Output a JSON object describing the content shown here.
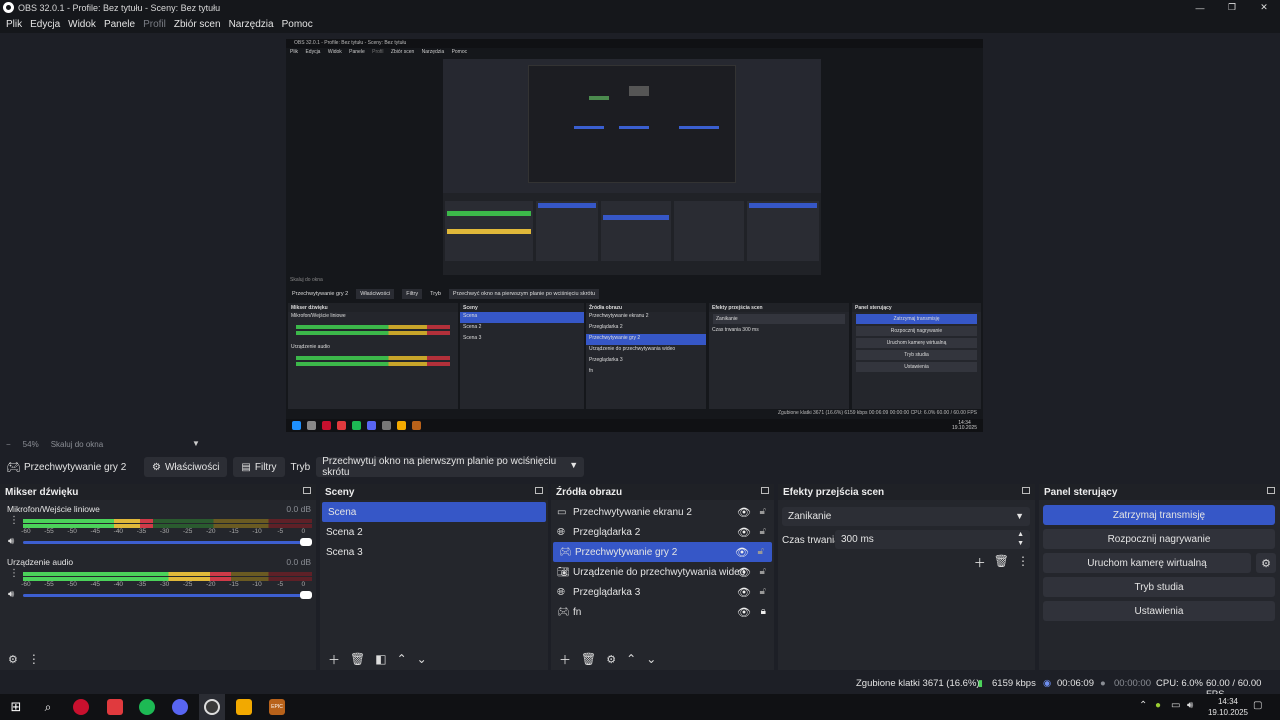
{
  "window": {
    "title": "OBS 32.0.1 - Profile: Bez tytułu - Sceny: Bez tytułu",
    "controls": {
      "minimize": "—",
      "restore": "❐",
      "close": "✕"
    }
  },
  "menu": [
    "Plik",
    "Edycja",
    "Widok",
    "Panele",
    "Profil",
    "Zbiór scen",
    "Narzędzia",
    "Pomoc"
  ],
  "menu_disabled": "Profil",
  "preview_nested": {
    "title": "OBS 32.0.1 - Profile: Bez tytułu - Sceny: Bez tytułu",
    "menu": [
      "Plik",
      "Edycja",
      "Widok",
      "Panele",
      "Profil",
      "Zbiór scen",
      "Narzędzia",
      "Pomoc"
    ],
    "scale": "Skaluj do okna",
    "source_name": "Przechwytywanie gry 2",
    "properties": "Właściwości",
    "filters": "Filtry",
    "mode_label": "Tryb",
    "mode_value": "Przechwyć okno na pierwszym planie po wciśnięciu skrótu",
    "docks": {
      "mixer": "Mikser dźwięku",
      "scenes": "Sceny",
      "sources": "Źródła obrazu",
      "transitions": "Efekty przejścia scen",
      "controls": "Panel sterujący"
    },
    "mixer_tracks": [
      "Mikrofon/Wejście liniowe",
      "Urządzenie audio"
    ],
    "scenes": [
      "Scena",
      "Scena 2",
      "Scena 3"
    ],
    "sources": [
      "Przechwytywanie ekranu 2",
      "Przeglądarka 2",
      "Przechwytywanie gry 2",
      "Urządzenie do przechwytywania wideo",
      "Przeglądarka 3",
      "fn"
    ],
    "transition": "Zanikanie",
    "duration_label": "Czas trwania",
    "duration": "300 ms",
    "controls": [
      "Zatrzymaj transmisję",
      "Rozpocznij nagrywanie",
      "Uruchom kamerę wirtualną",
      "Tryb studia",
      "Ustawienia"
    ],
    "status": "Zgubione klatki 3671 (16.6%)   6159 kbps   00:06:09   00:00:00   CPU: 6.0%   60.00 / 60.00 FPS",
    "clock_time": "14:34",
    "clock_date": "19.10.2025"
  },
  "zoom": {
    "minus": "−",
    "value": "54%",
    "scale_label": "Skaluj do okna"
  },
  "source_toolbar": {
    "source_name": "Przechwytywanie gry 2",
    "properties": "Właściwości",
    "filters": "Filtry",
    "mode_label": "Tryb",
    "mode_value": "Przechwytuj okno na pierwszym planie po wciśnięciu skrótu"
  },
  "mixer": {
    "title": "Mikser dźwięku",
    "tracks": [
      {
        "name": "Mikrofon/Wejście liniowe",
        "db": "0.0 dB",
        "level": 0.45
      },
      {
        "name": "Urządzenie audio",
        "db": "0.0 dB",
        "level": 0.72
      }
    ],
    "ticks": [
      "-60",
      "-55",
      "-50",
      "-45",
      "-40",
      "-35",
      "-30",
      "-25",
      "-20",
      "-15",
      "-10",
      "-5",
      "0"
    ]
  },
  "scenes": {
    "title": "Sceny",
    "items": [
      "Scena",
      "Scena 2",
      "Scena 3"
    ],
    "selected_index": 0
  },
  "sources": {
    "title": "Źródła obrazu",
    "items": [
      {
        "name": "Przechwytywanie ekranu 2",
        "icon": "monitor-icon",
        "locked": false
      },
      {
        "name": "Przeglądarka 2",
        "icon": "globe-icon",
        "locked": false
      },
      {
        "name": "Przechwytywanie gry 2",
        "icon": "gamepad-icon",
        "locked": false
      },
      {
        "name": "Urządzenie do przechwytywania wideo",
        "icon": "camera-icon",
        "locked": false
      },
      {
        "name": "Przeglądarka 3",
        "icon": "globe-icon",
        "locked": false
      },
      {
        "name": "fn",
        "icon": "gamepad-icon",
        "locked": true
      }
    ],
    "selected_index": 2
  },
  "transitions": {
    "title": "Efekty przejścia scen",
    "transition": "Zanikanie",
    "duration_label": "Czas trwania",
    "duration": "300 ms"
  },
  "controls": {
    "title": "Panel sterujący",
    "stream": "Zatrzymaj transmisję",
    "record": "Rozpocznij nagrywanie",
    "virtualcam": "Uruchom kamerę wirtualną",
    "studio": "Tryb studia",
    "settings": "Ustawienia"
  },
  "status": {
    "dropped": "Zgubione klatki 3671 (16.6%)",
    "bitrate": "6159 kbps",
    "stream_time": "00:06:09",
    "rec_time": "00:00:00",
    "cpu": "CPU: 6.0%",
    "fps": "60.00 / 60.00 FPS"
  },
  "taskbar": {
    "time": "14:34",
    "date": "19.10.2025",
    "apps": [
      "windows-start-icon",
      "search-icon",
      "opera-icon",
      "wps-icon",
      "spotify-icon",
      "discord-icon",
      "obs-icon",
      "rockstar-icon",
      "epic-games-icon"
    ],
    "app_colors": [
      "#1e90ff",
      "#ffffff",
      "#c8102e",
      "#e03a3e",
      "#1db954",
      "#5865f2",
      "#3a3a3a",
      "#f2a900",
      "#3a3a3a"
    ],
    "epic_label": "EPIC"
  }
}
